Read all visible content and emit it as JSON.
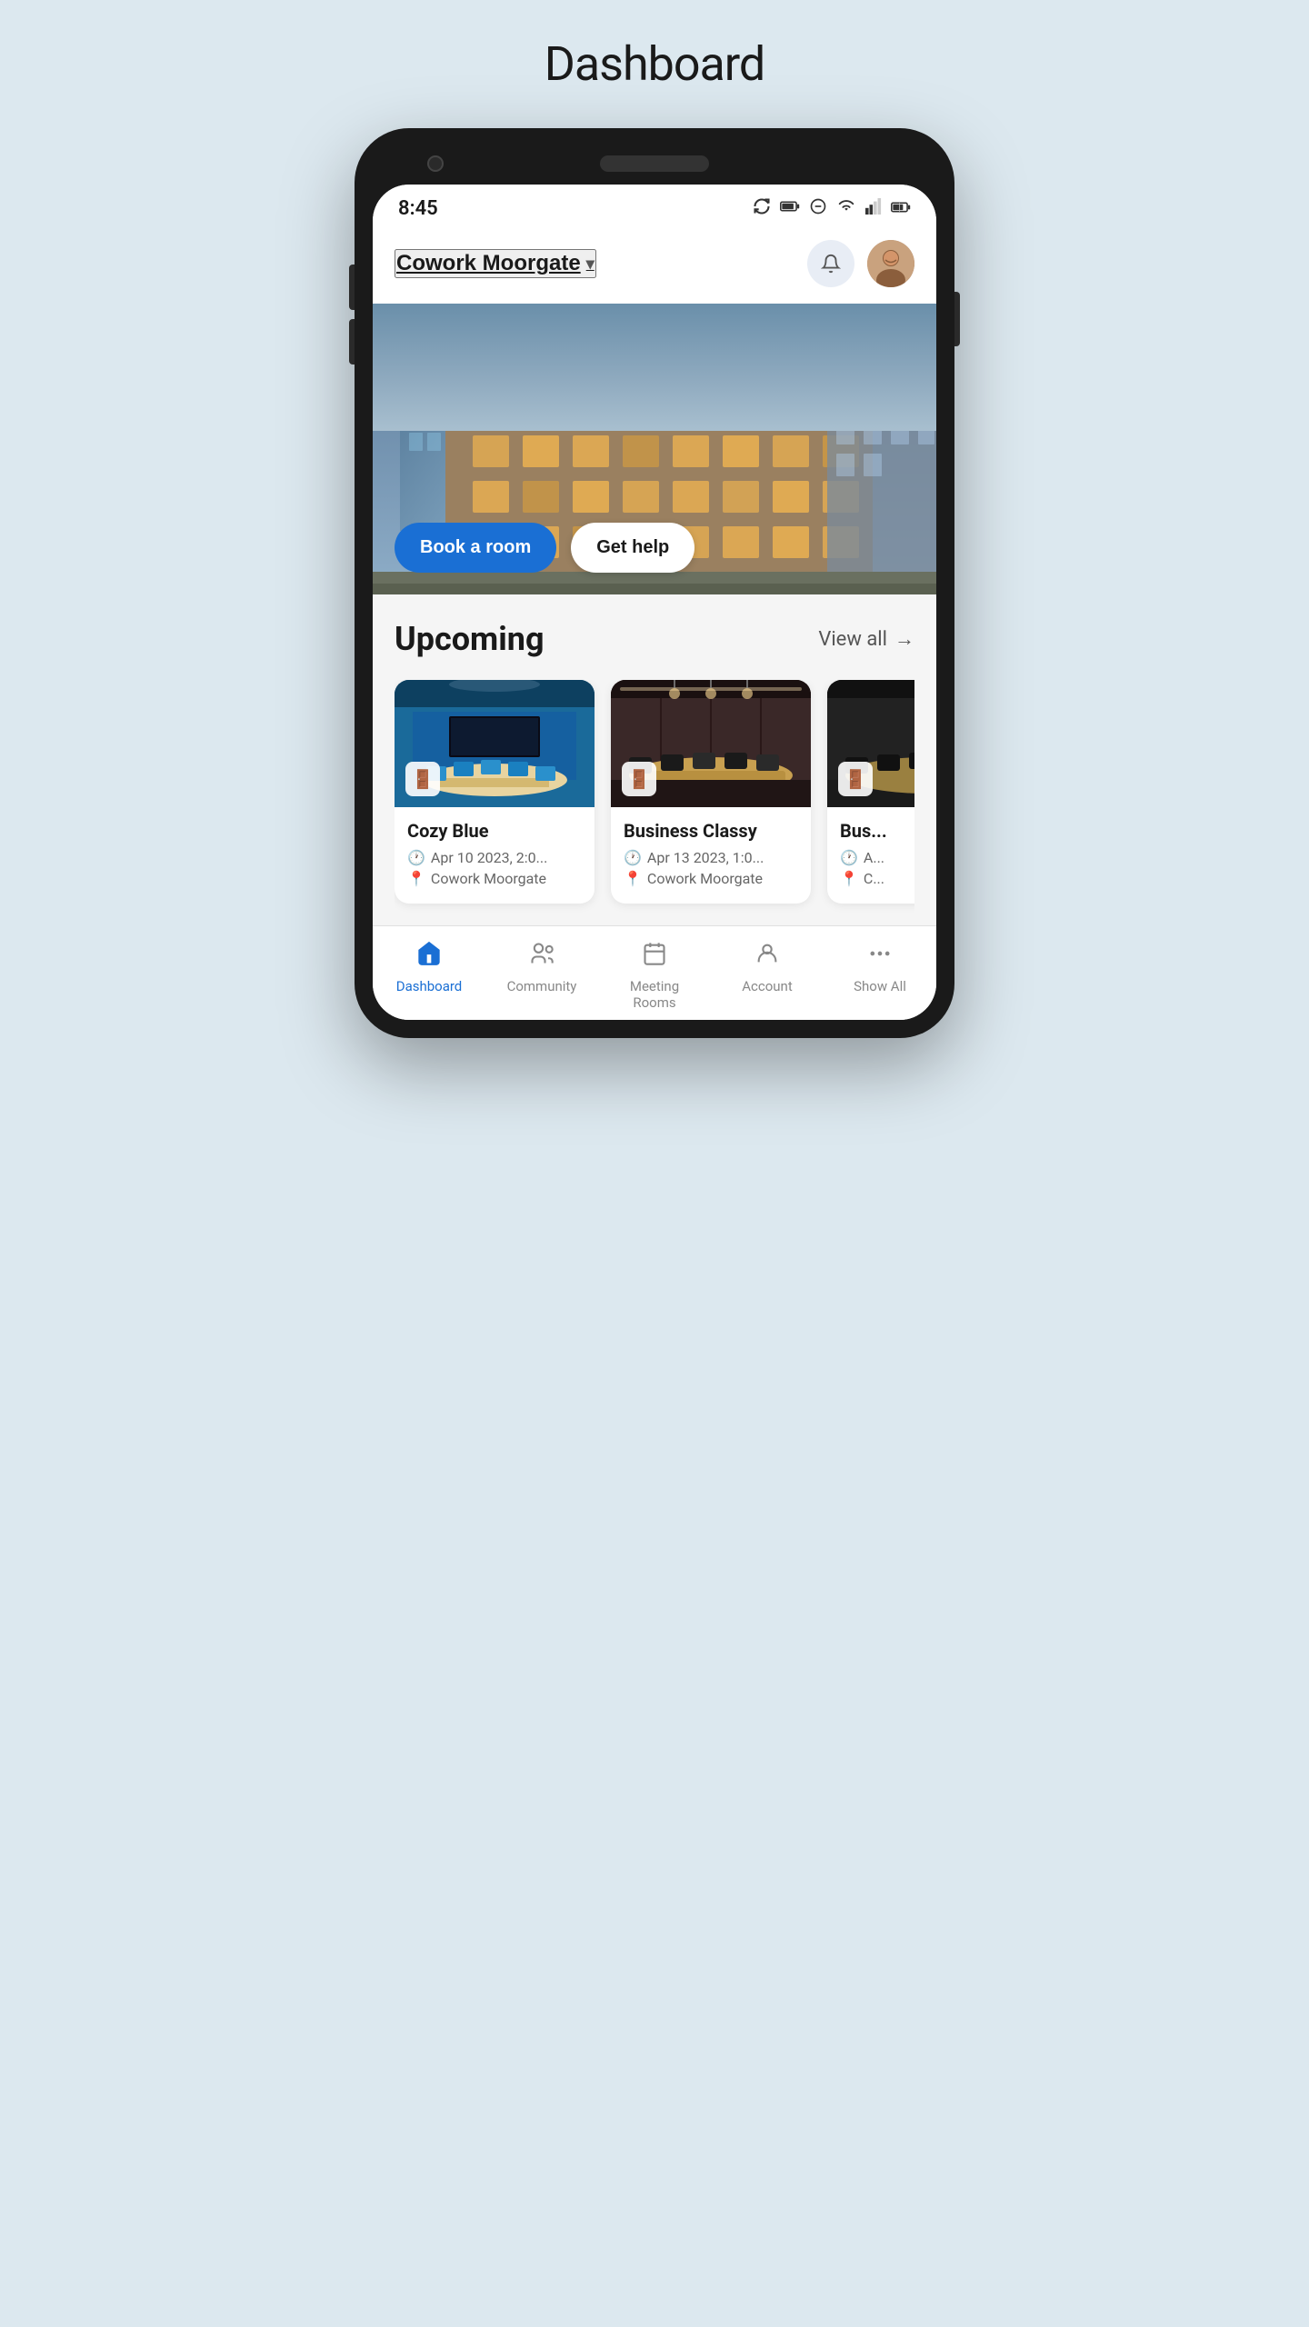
{
  "page": {
    "title": "Dashboard"
  },
  "status_bar": {
    "time": "8:45",
    "icons": [
      "●",
      "▮▮",
      "⊘",
      "▾▾",
      "◀▮",
      "⚡"
    ]
  },
  "header": {
    "location": "Cowork Moorgate",
    "chevron": "▾"
  },
  "hero": {
    "book_label": "Book a room",
    "help_label": "Get help"
  },
  "upcoming": {
    "section_title": "Upcoming",
    "view_all_label": "View all",
    "arrow": "→",
    "rooms": [
      {
        "name": "Cozy Blue",
        "date": "Apr 10 2023, 2:0...",
        "location": "Cowork Moorgate",
        "img_class": "room-img-cozy"
      },
      {
        "name": "Business Classy",
        "date": "Apr 13 2023, 1:0...",
        "location": "Cowork Moorgate",
        "img_class": "room-img-business"
      },
      {
        "name": "Bus...",
        "date": "A...",
        "location": "C...",
        "img_class": "room-img-third"
      }
    ]
  },
  "bottom_nav": {
    "items": [
      {
        "id": "dashboard",
        "label": "Dashboard",
        "icon": "🏠",
        "active": true
      },
      {
        "id": "community",
        "label": "Community",
        "icon": "👥",
        "active": false
      },
      {
        "id": "meeting-rooms",
        "label": "Meeting\nRooms",
        "icon": "📅",
        "active": false
      },
      {
        "id": "account",
        "label": "Account",
        "icon": "👤",
        "active": false
      },
      {
        "id": "show-all",
        "label": "Show All",
        "icon": "···",
        "active": false
      }
    ]
  }
}
